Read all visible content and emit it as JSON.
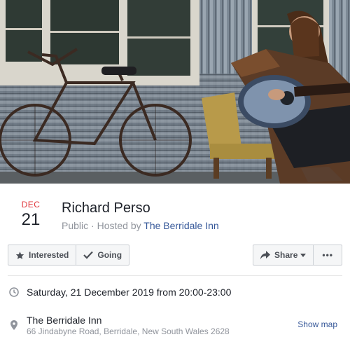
{
  "event": {
    "month": "DEC",
    "day": "21",
    "title": "Richard Perso",
    "visibility": "Public",
    "separator": "·",
    "hosted_prefix": "Hosted by",
    "host": "The Berridale Inn"
  },
  "actions": {
    "interested": "Interested",
    "going": "Going",
    "share": "Share",
    "more": "•••"
  },
  "details": {
    "datetime": "Saturday, 21 December 2019 from 20:00-23:00",
    "venue_name": "The Berridale Inn",
    "venue_address": "66 Jindabyne Road, Berridale, New South Wales 2628",
    "show_map": "Show map"
  },
  "icons": {
    "interested": "star-icon",
    "going": "check-icon",
    "share": "share-arrow-icon",
    "share_caret": "caret-down-icon",
    "time": "clock-icon",
    "location": "map-pin-icon"
  },
  "colors": {
    "month": "#e0393e",
    "link": "#365899",
    "muted": "#90949c",
    "button_bg": "#f5f6f7",
    "button_border": "#ccd0d5"
  }
}
